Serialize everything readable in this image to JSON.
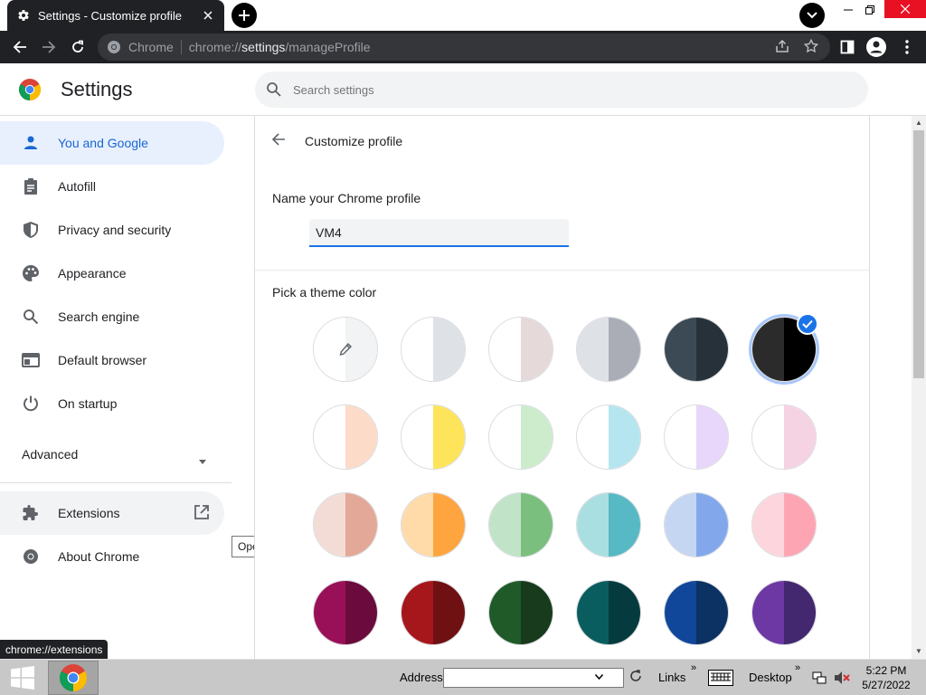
{
  "browser": {
    "tab_title": "Settings - Customize profile",
    "omnibox_chip": "Chrome",
    "url_scheme": "chrome://",
    "url_host": "settings",
    "url_path": "/manageProfile"
  },
  "header": {
    "title": "Settings",
    "search_placeholder": "Search settings"
  },
  "sidebar": {
    "items": [
      {
        "label": "You and Google",
        "icon": "person-icon",
        "active": true
      },
      {
        "label": "Autofill",
        "icon": "clipboard-icon"
      },
      {
        "label": "Privacy and security",
        "icon": "shield-icon"
      },
      {
        "label": "Appearance",
        "icon": "palette-icon"
      },
      {
        "label": "Search engine",
        "icon": "search-icon"
      },
      {
        "label": "Default browser",
        "icon": "browser-icon"
      },
      {
        "label": "On startup",
        "icon": "power-icon"
      }
    ],
    "advanced": "Advanced",
    "extensions": "Extensions",
    "about": "About Chrome",
    "tooltip": "Opens in a new tab"
  },
  "main": {
    "title": "Customize profile",
    "name_label": "Name your Chrome profile",
    "name_value": "VM4",
    "theme_label": "Pick a theme color",
    "swatches": [
      {
        "left": "#ffffff",
        "right": "#f1f3f4",
        "picker": true
      },
      {
        "left": "#ffffff",
        "right": "#dee1e6"
      },
      {
        "left": "#ffffff",
        "right": "#e6d9d9"
      },
      {
        "left": "#dee1e6",
        "right": "#aaadb6"
      },
      {
        "left": "#3c4a56",
        "right": "#26313a"
      },
      {
        "left": "#2b2b2b",
        "right": "#000000",
        "selected": true
      },
      {
        "left": "#ffffff",
        "right": "#fcdbc9"
      },
      {
        "left": "#ffffff",
        "right": "#fde45a"
      },
      {
        "left": "#ffffff",
        "right": "#cceccc"
      },
      {
        "left": "#ffffff",
        "right": "#b5e6f0"
      },
      {
        "left": "#ffffff",
        "right": "#e8d6fb"
      },
      {
        "left": "#ffffff",
        "right": "#f6d3e3"
      },
      {
        "left": "#f3dcd5",
        "right": "#e3a898"
      },
      {
        "left": "#fedba8",
        "right": "#fea53f"
      },
      {
        "left": "#c1e3c7",
        "right": "#7bbf7e"
      },
      {
        "left": "#a9dfe0",
        "right": "#57b9c4"
      },
      {
        "left": "#c5d6f3",
        "right": "#82a8eb"
      },
      {
        "left": "#fdd5dc",
        "right": "#fea5b4"
      },
      {
        "left": "#9a1058",
        "right": "#6b0a3c"
      },
      {
        "left": "#a5171b",
        "right": "#6f1013"
      },
      {
        "left": "#1f5a28",
        "right": "#173b1c"
      },
      {
        "left": "#0a5d5f",
        "right": "#053b3e"
      },
      {
        "left": "#11479a",
        "right": "#0b3262"
      },
      {
        "left": "#6d37a4",
        "right": "#432870"
      }
    ]
  },
  "status_bubble": "chrome://extensions",
  "taskbar": {
    "address_label": "Address",
    "links_label": "Links",
    "desktop_label": "Desktop",
    "time": "5:22 PM",
    "date": "5/27/2022"
  },
  "colors": {
    "accent": "#1a73e8",
    "active_nav_bg": "#e8f0fe",
    "active_nav_text": "#1967d2",
    "toolbar_bg": "#202124"
  }
}
